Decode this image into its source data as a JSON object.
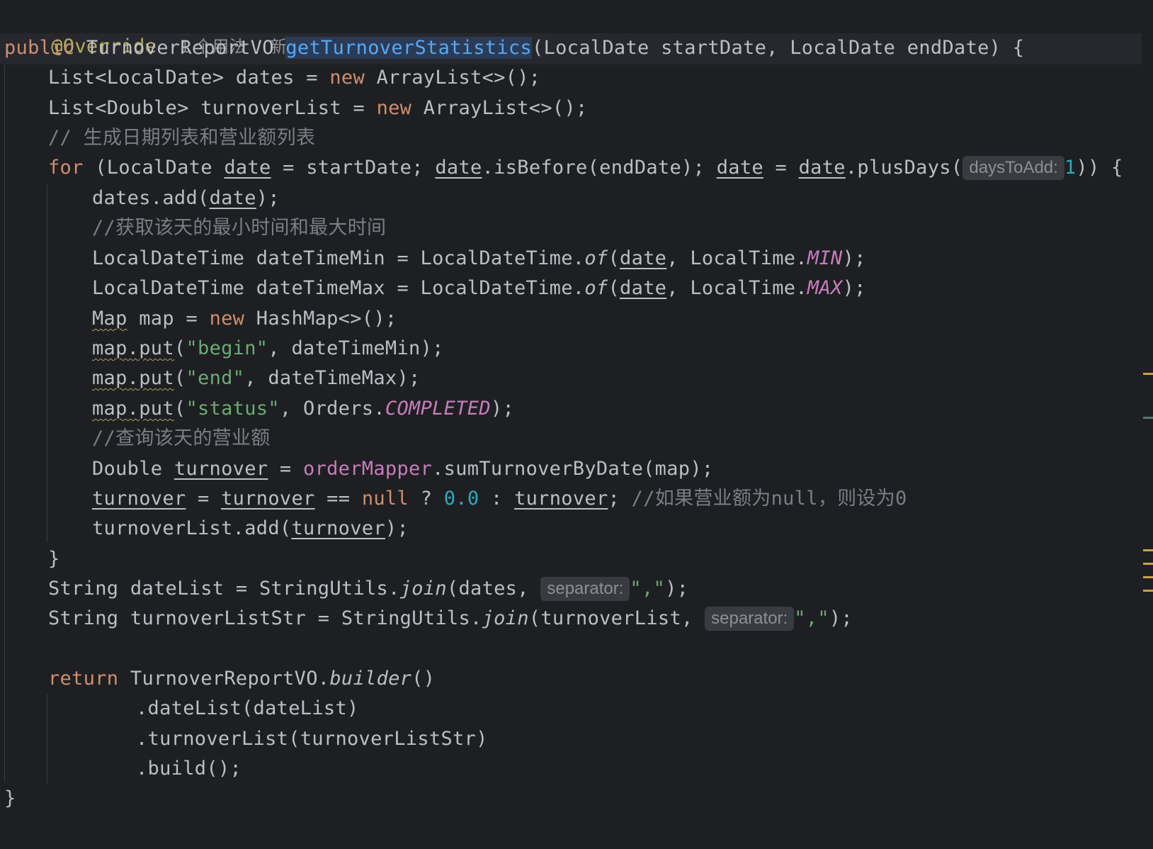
{
  "editor": {
    "annotation": "@Override",
    "usage_hint": "1 个用法",
    "new_hint": "新 *",
    "hints": {
      "days_to_add": "daysToAdd:",
      "separator1": "separator:",
      "separator2": "separator:"
    },
    "lines": {
      "l2": {
        "kw": "public",
        "t1": " TurnoverReportVO ",
        "fn": "getTurnoverStatistics",
        "t2": "(LocalDate startDate, LocalDate endDate) {"
      },
      "l3": {
        "t1": "List<LocalDate> dates = ",
        "kw": "new",
        "t2": " ArrayList<>();"
      },
      "l4": {
        "t1": "List<Double> turnoverList = ",
        "kw": "new",
        "t2": " ArrayList<>();"
      },
      "l5": {
        "c1": "// ",
        "c2": "生成日期列表和营业额列表"
      },
      "l6": {
        "kw": "for",
        "t1": " (LocalDate ",
        "v1": "date",
        "t2": " = startDate; ",
        "v2": "date",
        "t3": ".isBefore(endDate); ",
        "v3": "date",
        "t4": " = ",
        "v4": "date",
        "t5": ".plusDays(",
        "num": "1",
        "t6": ")) {"
      },
      "l7": {
        "t1": "dates.add(",
        "v1": "date",
        "t2": ");"
      },
      "l8": {
        "c1": "//",
        "c2": "获取该天的最小时间和最大时间"
      },
      "l9": {
        "t1": "LocalDateTime dateTimeMin = LocalDateTime.",
        "it": "of",
        "t2": "(",
        "v1": "date",
        "t3": ", LocalTime.",
        "const": "MIN",
        "t4": ");"
      },
      "l10": {
        "t1": "LocalDateTime dateTimeMax = LocalDateTime.",
        "it": "of",
        "t2": "(",
        "v1": "date",
        "t3": ", LocalTime.",
        "const": "MAX",
        "t4": ");"
      },
      "l11": {
        "w1": "Map",
        "t1": " map = ",
        "kw": "new",
        "t2": " HashMap<>();"
      },
      "l12": {
        "w1": "map.put",
        "t1": "(",
        "str": "\"begin\"",
        "t2": ", dateTimeMin);"
      },
      "l13": {
        "w1": "map.put",
        "t1": "(",
        "str": "\"end\"",
        "t2": ", dateTimeMax);"
      },
      "l14": {
        "w1": "map.put",
        "t1": "(",
        "str": "\"status\"",
        "t2": ", Orders.",
        "const": "COMPLETED",
        "t3": ");"
      },
      "l15": {
        "c1": "//",
        "c2": "查询该天的营业额"
      },
      "l16": {
        "t1": "Double ",
        "v1": "turnover",
        "t2": " = ",
        "field": "orderMapper",
        "t3": ".sumTurnoverByDate(map);"
      },
      "l17": {
        "v1": "turnover",
        "t1": " = ",
        "v2": "turnover",
        "t2": " == ",
        "kw": "null",
        "t3": " ? ",
        "num": "0.0",
        "t4": " : ",
        "v3": "turnover",
        "t5": "; ",
        "c1": "//",
        "c2": "如果营业额为",
        "c3": "null",
        "c4": "，则设为",
        "c5": "0"
      },
      "l18": {
        "t1": "turnoverList.add(",
        "v1": "turnover",
        "t2": ");"
      },
      "l19": {
        "t1": "}"
      },
      "l20": {
        "t1": "String dateList = StringUtils.",
        "it": "join",
        "t2": "(dates, ",
        "str": "\",\"",
        "t3": ");"
      },
      "l21": {
        "t1": "String turnoverListStr = StringUtils.",
        "it": "join",
        "t2": "(turnoverList, ",
        "str": "\",\"",
        "t3": ");"
      },
      "l23": {
        "kw": "return",
        "t1": " TurnoverReportVO.",
        "it": "builder",
        "t2": "()"
      },
      "l24": {
        "t1": ".dateList(dateList)"
      },
      "l25": {
        "t1": ".turnoverList(turnoverListStr)"
      },
      "l26": {
        "t1": ".build();"
      },
      "l27": {
        "t1": "}"
      }
    }
  },
  "colors": {
    "background": "#1e1f22",
    "keyword": "#cf8e6d",
    "function": "#56a8f5",
    "string": "#6aab73",
    "number": "#2aacb8",
    "constant": "#c77dbb",
    "comment": "#7a7e85",
    "annotation": "#b3ae60"
  }
}
